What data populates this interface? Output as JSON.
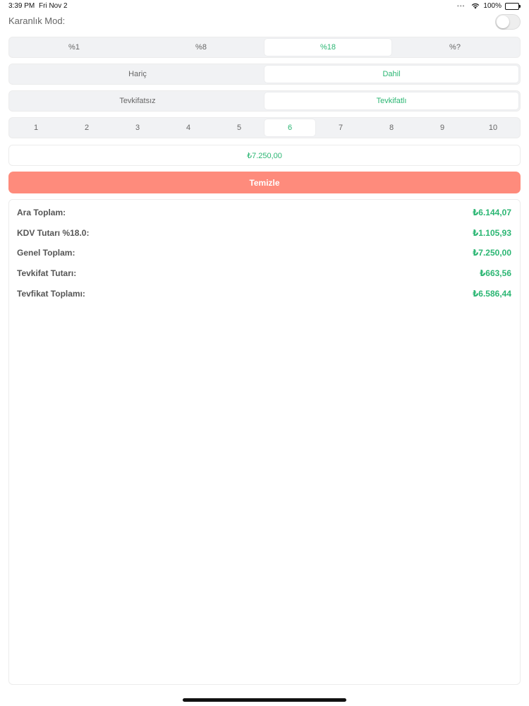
{
  "status": {
    "time": "3:39 PM",
    "date": "Fri Nov 2",
    "battery": "100%",
    "battery_level": 1.0
  },
  "dark_mode": {
    "label": "Karanlık Mod:",
    "enabled": false
  },
  "rate_segment": {
    "options": [
      "%1",
      "%8",
      "%18",
      "%?"
    ],
    "selected": "%18"
  },
  "vat_mode_segment": {
    "options": [
      "Hariç",
      "Dahil"
    ],
    "selected": "Dahil"
  },
  "withholding_segment": {
    "options": [
      "Tevkifatsız",
      "Tevkifatlı"
    ],
    "selected": "Tevkifatlı"
  },
  "ratio_segment": {
    "options": [
      "1",
      "2",
      "3",
      "4",
      "5",
      "6",
      "7",
      "8",
      "9",
      "10"
    ],
    "selected": "6"
  },
  "amount_input": {
    "value": "₺7.250,00"
  },
  "clear_button": {
    "label": "Temizle"
  },
  "accent_color": "#2bb673",
  "clear_color": "#fe8b7c",
  "results": [
    {
      "label": "Ara Toplam:",
      "value": "₺6.144,07"
    },
    {
      "label": "KDV Tutarı %18.0:",
      "value": "₺1.105,93"
    },
    {
      "label": "Genel Toplam:",
      "value": "₺7.250,00"
    },
    {
      "label": "Tevkifat Tutarı:",
      "value": "₺663,56"
    },
    {
      "label": "Tevfikat Toplamı:",
      "value": "₺6.586,44"
    }
  ]
}
